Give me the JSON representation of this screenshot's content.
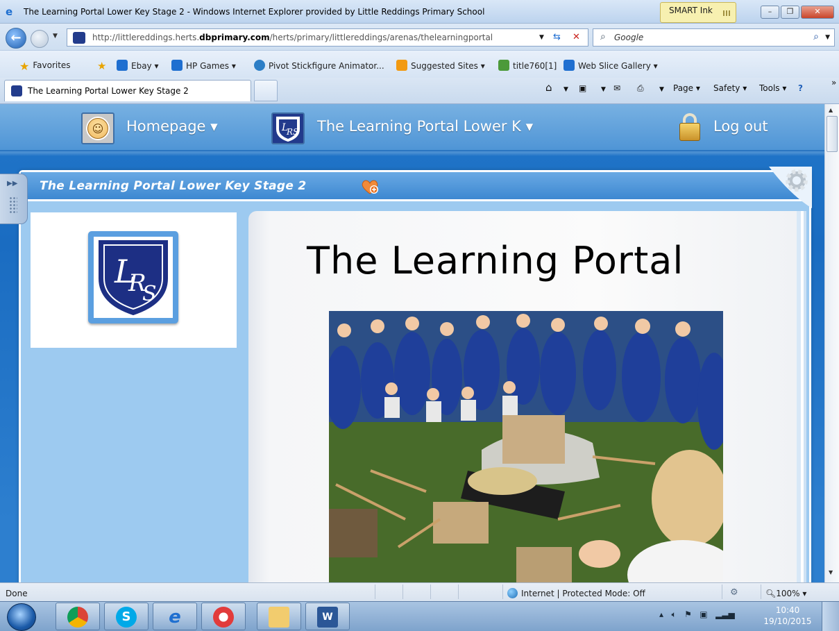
{
  "window": {
    "title": "The Learning Portal Lower Key Stage 2 - Windows Internet Explorer provided by Little Reddings Primary School",
    "smart_ink": "SMART Ink",
    "minimize": "–",
    "restore": "❐",
    "close": "✕"
  },
  "address": {
    "url_prefix": "http://littlereddings.herts.",
    "url_bold": "dbprimary.com",
    "url_suffix": "/herts/primary/littlereddings/arenas/thelearningportal",
    "search_placeholder": "Google"
  },
  "favorites_bar": {
    "favorites_label": "Favorites",
    "items": [
      {
        "label": "Ebay ▾"
      },
      {
        "label": "HP Games ▾"
      },
      {
        "label": "Pivot Stickfigure Animator..."
      },
      {
        "label": "Suggested Sites ▾"
      },
      {
        "label": "title760[1]"
      },
      {
        "label": "Web Slice Gallery ▾"
      }
    ]
  },
  "tabs": {
    "active_label": "The Learning Portal Lower Key Stage 2"
  },
  "command_bar": {
    "page": "Page ▾",
    "safety": "Safety ▾",
    "tools": "Tools ▾",
    "more": "»"
  },
  "site_nav": {
    "homepage": "Homepage ▾",
    "portal": "The Learning Portal Lower K ▾",
    "logout": "Log out"
  },
  "frame": {
    "title": "The Learning Portal Lower Key Stage 2"
  },
  "logo": {
    "letters_top": "L",
    "letters_mid": "R",
    "letters_bottom": "S"
  },
  "content": {
    "heading": "The Learning Portal"
  },
  "status_bar": {
    "status": "Done",
    "zone": "Internet | Protected Mode: Off",
    "zoom": "100%"
  },
  "taskbar": {
    "time": "10:40",
    "date": "19/10/2015"
  },
  "colors": {
    "site_blue": "#2d7fcf",
    "frame_blue": "#9dcaf0"
  }
}
